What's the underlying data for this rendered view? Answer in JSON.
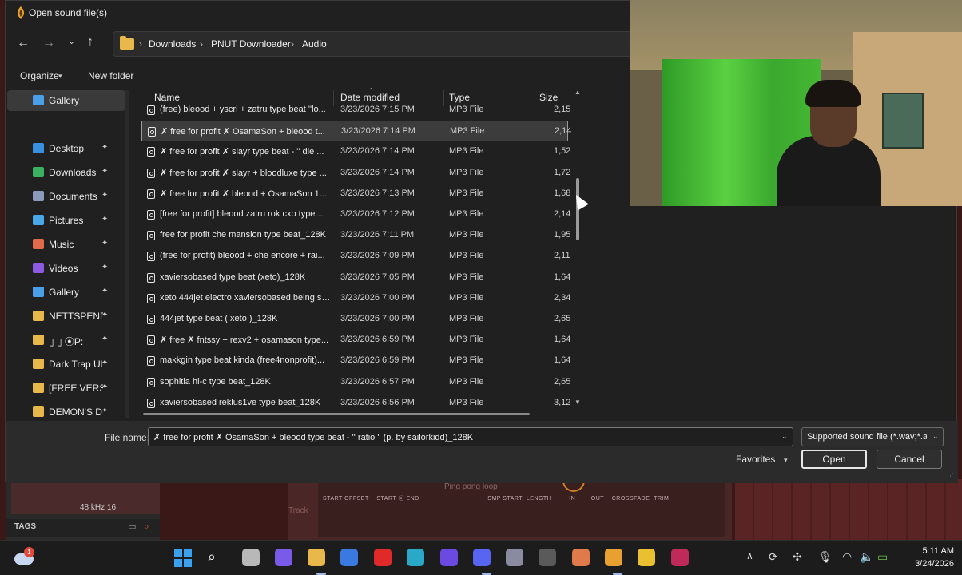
{
  "dialog": {
    "title": "Open sound file(s)",
    "close_glyph": "✕"
  },
  "nav": {
    "back_glyph": "←",
    "forward_glyph": "→",
    "recent_glyph": "⌄",
    "up_glyph": "↑"
  },
  "breadcrumb": {
    "separator": "›",
    "items": [
      "Downloads",
      "PNUT Downloader",
      "Audio"
    ]
  },
  "toolbar": {
    "organize_label": "Organize",
    "organize_chevron": "▾",
    "new_folder_label": "New folder"
  },
  "sidebar": {
    "pin_glyph": "✦",
    "items": [
      {
        "label": "Gallery",
        "icon": "gallery-icon",
        "color": "#4aa0e8",
        "pinned": false
      },
      {
        "label": "Desktop",
        "icon": "desktop-icon",
        "color": "#3a90e0",
        "pinned": true
      },
      {
        "label": "Downloads",
        "icon": "download-icon",
        "color": "#3ab060",
        "pinned": true
      },
      {
        "label": "Documents",
        "icon": "document-icon",
        "color": "#8a9ab8",
        "pinned": true
      },
      {
        "label": "Pictures",
        "icon": "pictures-icon",
        "color": "#4aa8e8",
        "pinned": true
      },
      {
        "label": "Music",
        "icon": "music-icon",
        "color": "#e06a4a",
        "pinned": true
      },
      {
        "label": "Videos",
        "icon": "videos-icon",
        "color": "#8a5ae0",
        "pinned": true
      },
      {
        "label": "Gallery",
        "icon": "gallery-icon",
        "color": "#4aa0e8",
        "pinned": true
      },
      {
        "label": "NETTSPEND",
        "icon": "folder-icon",
        "color": "#e8b84a",
        "pinned": true
      },
      {
        "label": "▯ ▯ ⦿P:",
        "icon": "folder-icon",
        "color": "#e8b84a",
        "pinned": true
      },
      {
        "label": "Dark Trap Ult",
        "icon": "folder-icon",
        "color": "#e8b84a",
        "pinned": true
      },
      {
        "label": "[FREE VERSIC",
        "icon": "folder-icon",
        "color": "#e8b84a",
        "pinned": true
      },
      {
        "label": "DEMON'S DF",
        "icon": "folder-icon",
        "color": "#e8b84a",
        "pinned": true
      }
    ]
  },
  "columns": {
    "name": "Name",
    "date": "Date modified",
    "type": "Type",
    "size": "Size",
    "sort_glyph": "⌃"
  },
  "files": [
    {
      "name": "(free) bleood + yscri + zatru type beat ''lo...",
      "date": "3/23/2026 7:15 PM",
      "type": "MP3 File",
      "size": "2,15"
    },
    {
      "name": "✗ free for profit ✗ OsamaSon + bleood t...",
      "date": "3/23/2026 7:14 PM",
      "type": "MP3 File",
      "size": "2,14",
      "selected": true
    },
    {
      "name": "✗ free for profit ✗ slayr type beat - '' die ...",
      "date": "3/23/2026 7:14 PM",
      "type": "MP3 File",
      "size": "1,52"
    },
    {
      "name": "✗ free for profit ✗ slayr + bloodluxe type ...",
      "date": "3/23/2026 7:14 PM",
      "type": "MP3 File",
      "size": "1,72"
    },
    {
      "name": "✗ free for profit ✗ bleood + OsamaSon 1...",
      "date": "3/23/2026 7:13 PM",
      "type": "MP3 File",
      "size": "1,68"
    },
    {
      "name": "[free for profit] bleood zatru rok cxo type ...",
      "date": "3/23/2026 7:12 PM",
      "type": "MP3 File",
      "size": "2,14"
    },
    {
      "name": "free for profit che mansion type beat_128K",
      "date": "3/23/2026 7:11 PM",
      "type": "MP3 File",
      "size": "1,95"
    },
    {
      "name": "(free for profit) bleood + che encore + rai...",
      "date": "3/23/2026 7:09 PM",
      "type": "MP3 File",
      "size": "2,11"
    },
    {
      "name": "xaviersobased type beat (xeto)_128K",
      "date": "3/23/2026 7:05 PM",
      "type": "MP3 File",
      "size": "1,64"
    },
    {
      "name": "xeto 444jet electro xaviersobased being si...",
      "date": "3/23/2026 7:00 PM",
      "type": "MP3 File",
      "size": "2,34"
    },
    {
      "name": "444jet type beat ( xeto )_128K",
      "date": "3/23/2026 7:00 PM",
      "type": "MP3 File",
      "size": "2,65"
    },
    {
      "name": "✗ free ✗ fntssy + rexv2 + osamason type...",
      "date": "3/23/2026 6:59 PM",
      "type": "MP3 File",
      "size": "1,64"
    },
    {
      "name": "makkgin type beat kinda (free4nonprofit)...",
      "date": "3/23/2026 6:59 PM",
      "type": "MP3 File",
      "size": "1,64"
    },
    {
      "name": "sophitia hi-c type beat_128K",
      "date": "3/23/2026 6:57 PM",
      "type": "MP3 File",
      "size": "2,65"
    },
    {
      "name": "xaviersobased reklus1ve type beat_128K",
      "date": "3/23/2026 6:56 PM",
      "type": "MP3 File",
      "size": "3,12"
    }
  ],
  "footer": {
    "file_name_label": "File name:",
    "file_name_value": "✗ free for profit ✗ OsamaSon + bleood type beat - '' ratio '' (p. by sailorkidd)_128K",
    "filter_value": "Supported sound file (*.wav;*.a",
    "favorites_label": "Favorites",
    "open_label": "Open",
    "cancel_label": "Cancel",
    "chevron": "⌄"
  },
  "background_app": {
    "sample_rate": "48 kHz 16",
    "tags_label": "TAGS",
    "ping_pong_label": "Ping pong loop",
    "knob_labels": "START OFFSET    START ⦿ END                                   SMP START  LENGTH         IN        OUT    CROSSFADE  TRIM",
    "track_label": "Track"
  },
  "taskbar": {
    "weather_badge": "1",
    "time": "5:11 AM",
    "date": "3/24/2026",
    "search_glyph": "⌕",
    "tray_chevron": "∧",
    "apps": [
      {
        "name": "task-view",
        "color": "#b8b8b8"
      },
      {
        "name": "copilot",
        "color": "#7a5ae8"
      },
      {
        "name": "file-explorer",
        "color": "#e8b84a"
      },
      {
        "name": "outlook",
        "color": "#3a7ae0"
      },
      {
        "name": "opera",
        "color": "#e02a2a"
      },
      {
        "name": "edge",
        "color": "#2aa8c8"
      },
      {
        "name": "video-editor",
        "color": "#6a4ae0"
      },
      {
        "name": "discord",
        "color": "#5865f2"
      },
      {
        "name": "camera",
        "color": "#8a8aa0"
      },
      {
        "name": "app-red-dot",
        "color": "#5a5a5a"
      },
      {
        "name": "game-app",
        "color": "#e07a4a"
      },
      {
        "name": "fl-studio",
        "color": "#e8a030"
      },
      {
        "name": "chrome",
        "color": "#e8c030"
      },
      {
        "name": "opera-gx",
        "color": "#c02a5a"
      }
    ]
  }
}
